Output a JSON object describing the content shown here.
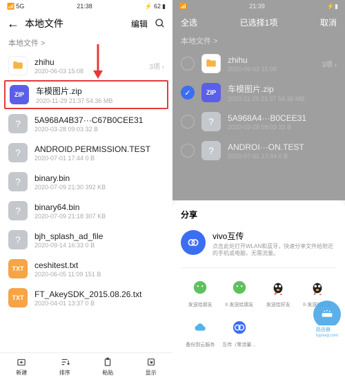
{
  "left": {
    "status": {
      "time": "21:38",
      "signal": "5G",
      "battery": "62"
    },
    "title": "本地文件",
    "edit": "编辑",
    "breadcrumb": "本地文件 >",
    "arrow_color": "#e63939",
    "files": [
      {
        "name": "zhihu",
        "meta": "2020-06-03 15:08",
        "count": "3项",
        "icon": "folder"
      },
      {
        "name": "车模图片.zip",
        "meta": "2020-11-29 21:37   54.36 MB",
        "icon": "zip",
        "hl": true
      },
      {
        "name": "5A968A4B37···C67B0CEE31",
        "meta": "2020-03-28 09:03   32 B",
        "icon": "gray"
      },
      {
        "name": "ANDROID.PERMISSION.TEST",
        "meta": "2020-07-01 17:44   0 B",
        "icon": "gray"
      },
      {
        "name": "binary.bin",
        "meta": "2020-07-09 21:30   392 KB",
        "icon": "gray"
      },
      {
        "name": "binary64.bin",
        "meta": "2020-07-09 21:18   307 KB",
        "icon": "gray"
      },
      {
        "name": "bjh_splash_ad_file",
        "meta": "2020-09-14 16:33   0 B",
        "icon": "gray"
      },
      {
        "name": "ceshitest.txt",
        "meta": "2020-06-05 11:09   151 B",
        "icon": "txt"
      },
      {
        "name": "FT_AkeySDK_2015.08.26.txt",
        "meta": "2020-04-01 13:37   0 B",
        "icon": "txt"
      }
    ],
    "bottom": [
      {
        "label": "新建",
        "icon": "new"
      },
      {
        "label": "排序",
        "icon": "sort"
      },
      {
        "label": "粘贴",
        "icon": "paste"
      },
      {
        "label": "显示",
        "icon": "show"
      }
    ]
  },
  "right": {
    "status": {
      "time": "21:39"
    },
    "selbar": {
      "all": "全选",
      "title": "已选择1项",
      "cancel": "取消"
    },
    "breadcrumb": "本地文件 >",
    "files": [
      {
        "name": "zhihu",
        "meta": "2020-06-03 15:08",
        "count": "3项",
        "icon": "folder",
        "checked": false
      },
      {
        "name": "车模图片.zip",
        "meta": "2020-11-29 21:37   54.36 MB",
        "icon": "zip",
        "checked": true
      },
      {
        "name": "5A968A4···B0CEE31",
        "meta": "2020-03-28 09:03   32 B",
        "icon": "gray",
        "checked": false
      },
      {
        "name": "ANDROI···ON.TEST",
        "meta": "2020-07-01 17:44   0 B",
        "icon": "gray",
        "checked": false
      }
    ],
    "share": {
      "title": "分享",
      "vivo_title": "vivo互传",
      "vivo_desc": "点击此处打开WLAN和蓝牙，快速分享文件给附近的手机或电脑，无需流量。",
      "apps_row1": [
        {
          "label": "发送给朋友",
          "bg": "#5ec15e"
        },
        {
          "label": "II·发送给朋友",
          "bg": "#5ec15e"
        },
        {
          "label": "发送给好友",
          "bg": "#222"
        },
        {
          "label": "II·发送给好友",
          "bg": "#222"
        }
      ],
      "apps_row2": [
        {
          "label": "备份到云服务",
          "bg": "#4fb4ea"
        },
        {
          "label": "互传（零流量…",
          "bg": "#3b6ef0"
        },
        {
          "label": "",
          "bg": ""
        },
        {
          "label": "",
          "bg": ""
        }
      ]
    }
  },
  "watermark": {
    "text": "路由器",
    "url": "luyouqi.com"
  }
}
